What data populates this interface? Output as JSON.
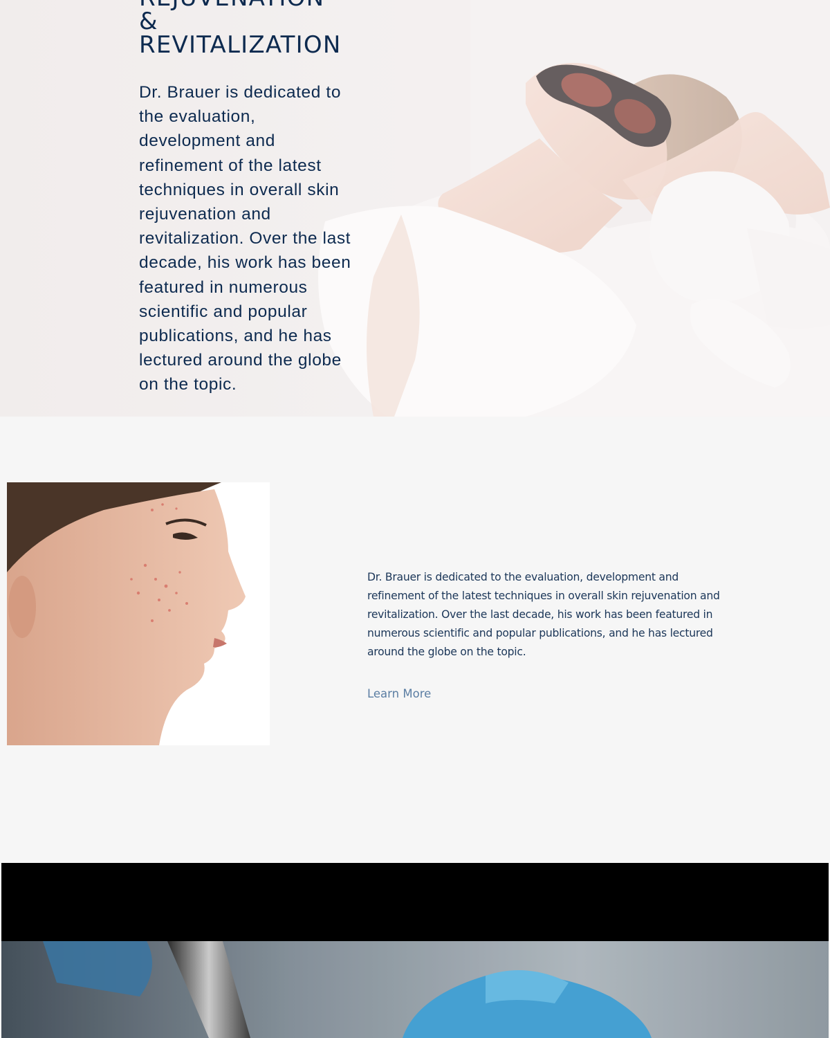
{
  "hero": {
    "title": "REJUVENATION\n&\nREVITALIZATION",
    "body": "Dr. Brauer is dedicated to the evaluation, development and refinement of the latest techniques in overall skin rejuvenation and revitalization. Over the last decade, his work has been featured in numerous scientific and popular publications, and he has lectured around the globe on the topic."
  },
  "feature": {
    "body": "Dr. Brauer is dedicated to the evaluation, development and refinement of the latest techniques in overall skin rejuvenation and revitalization. Over the last decade, his work has been featured in numerous scientific and popular publications, and he has lectured around the globe on the topic.",
    "link_label": "Learn More"
  },
  "colors": {
    "navy_text": "#0d2a4f",
    "link": "#5b7ea3",
    "page_bg": "#f6f6f6"
  }
}
